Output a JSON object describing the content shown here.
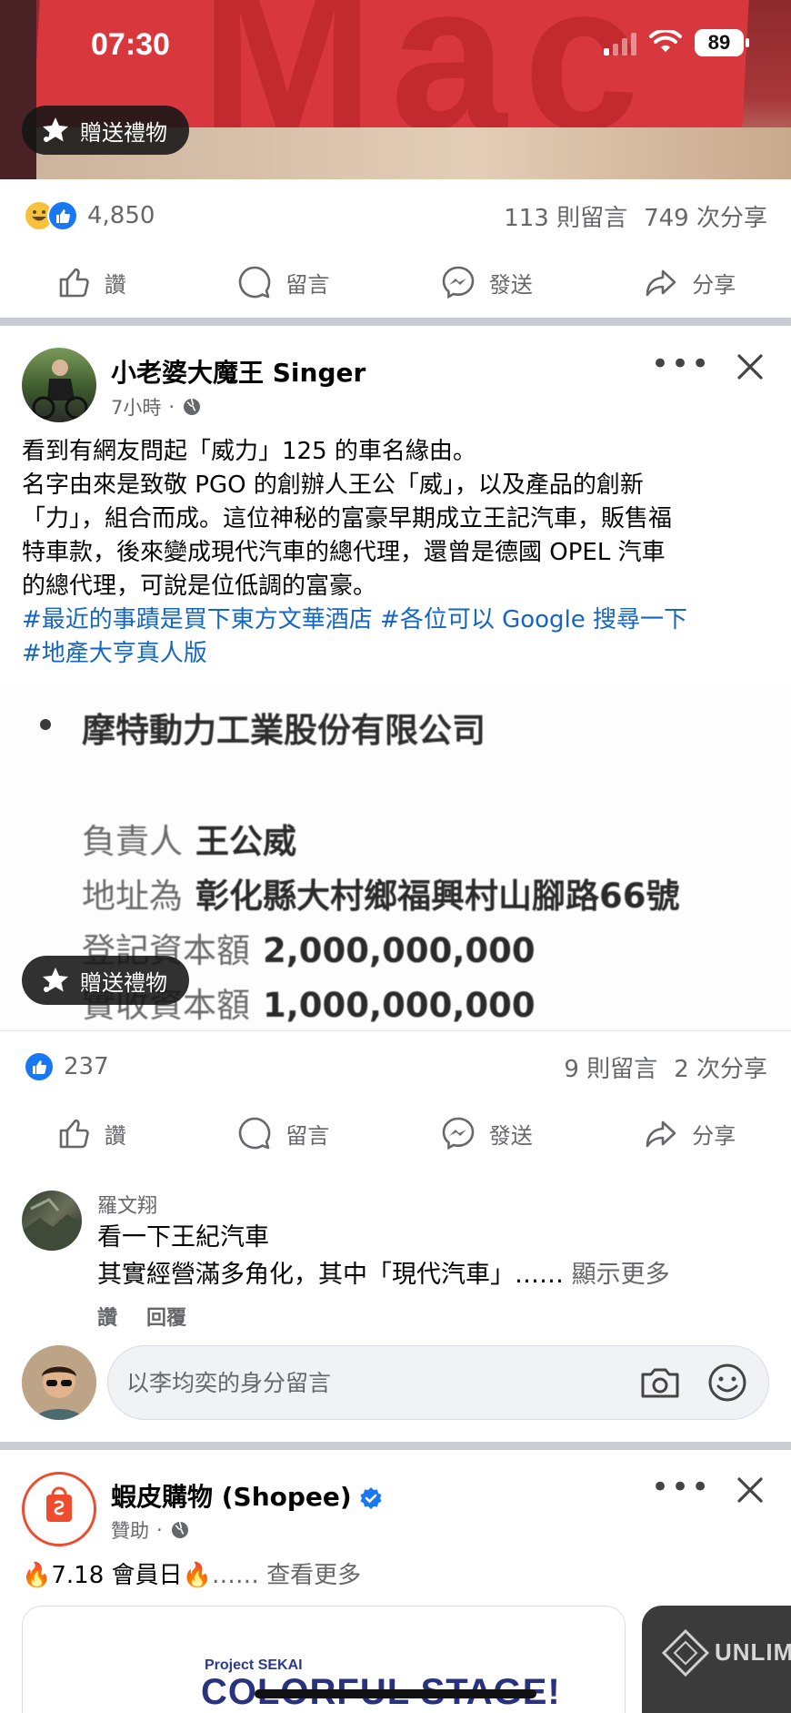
{
  "status_bar": {
    "time": "07:30",
    "battery": "89"
  },
  "post1": {
    "gift_label": "贈送禮物",
    "reaction_count": "4,850",
    "comments_count": "113 則留言",
    "shares_count": "749 次分享"
  },
  "actions": {
    "like": "讚",
    "comment": "留言",
    "send": "發送",
    "share": "分享"
  },
  "post2": {
    "author": "小老婆大魔王 Singer",
    "time": "7小時",
    "text_lines": [
      "看到有網友問起「威力」125 的車名緣由。",
      "名字由來是致敬 PGO 的創辦人王公「威」，以及產品的創新",
      "「力」，組合而成。這位神秘的富豪早期成立王記汽車，販售福",
      "特車款，後來變成現代汽車的總代理，還曾是德國 OPEL 汽車",
      "的總代理，可說是位低調的富豪。"
    ],
    "hashtag_lines": [
      "#最近的事蹟是買下東方文華酒店 #各位可以 Google 搜尋一下",
      "#地產大亨真人版"
    ],
    "image": {
      "company": "摩特動力工業股份有限公司",
      "rows": [
        {
          "label": "負責人",
          "value": "王公威"
        },
        {
          "label": "地址為",
          "value": "彰化縣大村鄉福興村山腳路66號"
        },
        {
          "label": "登記資本額",
          "value": "2,000,000,000"
        },
        {
          "label": "實收資本額",
          "value": "1,000,000,000"
        }
      ]
    },
    "gift_label": "贈送禮物",
    "reaction_count": "237",
    "comments_count": "9 則留言",
    "shares_count": "2 次分享",
    "comment": {
      "author": "羅文翔",
      "line1": "看一下王紀汽車",
      "line2": "其實經營滿多角化，其中「現代汽車」……",
      "show_more": "顯示更多",
      "like": "讚",
      "reply": "回覆"
    },
    "comment_input_placeholder": "以李均奕的身分留言"
  },
  "post3": {
    "author": "蝦皮購物 (Shopee)",
    "meta": "贊助",
    "promo_text": "7.18 會員日",
    "promo_more": "…… 查看更多",
    "card1": {
      "small": "Project SEKAI",
      "big": "COLORFUL STAGE!"
    },
    "card2": {
      "brand": "UNLIMIT"
    }
  },
  "colors": {
    "link": "#1566c0",
    "like_blue": "#1877f2",
    "shopee": "#ee4d2d"
  }
}
